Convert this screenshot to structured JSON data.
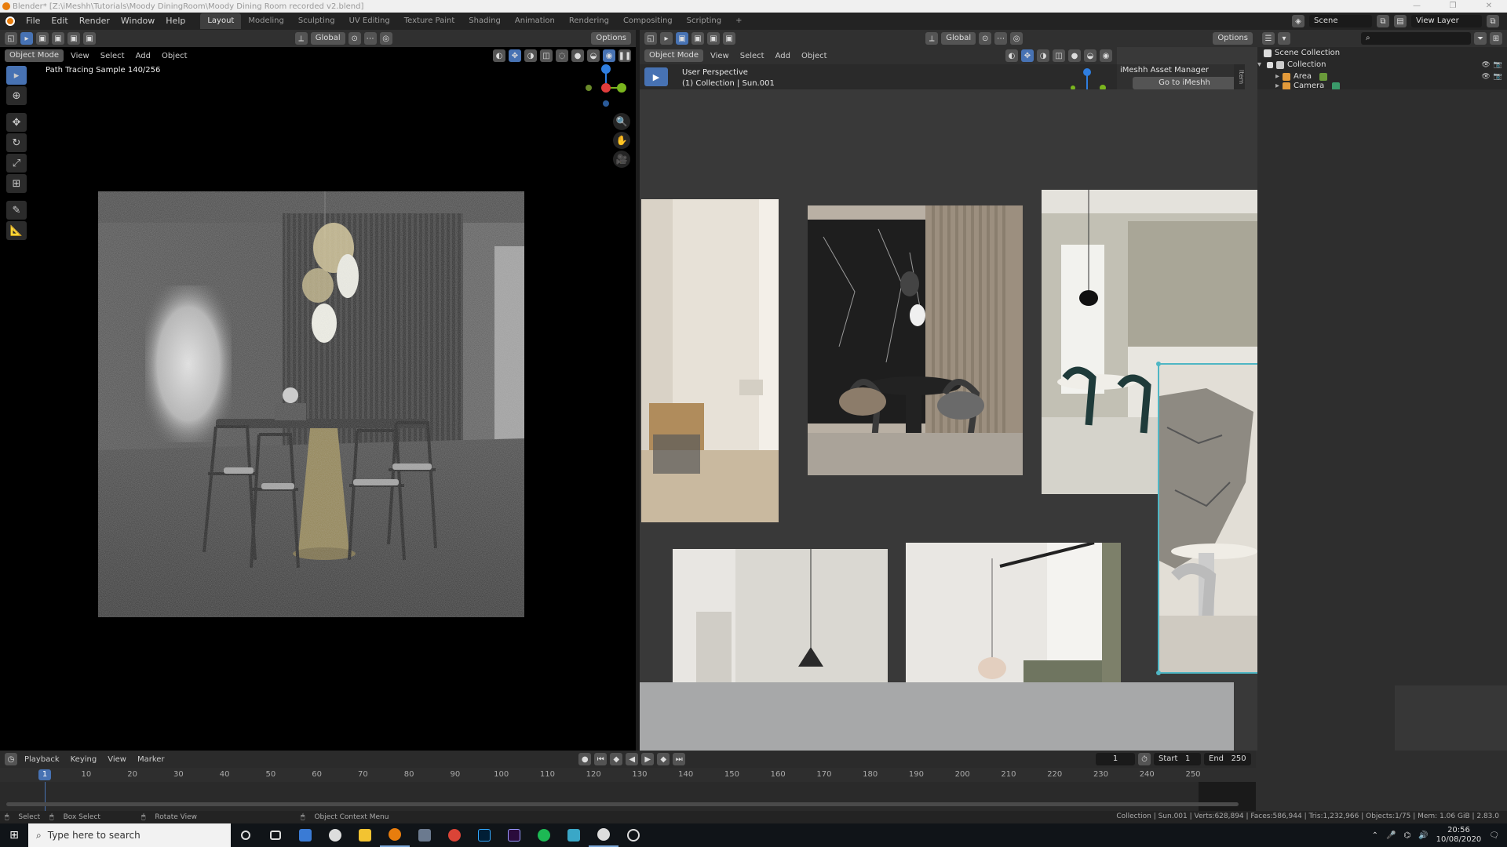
{
  "window": {
    "title": "Blender* [Z:\\iMeshh\\Tutorials\\Moody DiningRoom\\Moody Dining Room recorded v2.blend]",
    "controls": [
      "—",
      "❐",
      "✕"
    ]
  },
  "menubar": {
    "items": [
      "File",
      "Edit",
      "Render",
      "Window",
      "Help"
    ],
    "workspaces": [
      "Layout",
      "Modeling",
      "Sculpting",
      "UV Editing",
      "Texture Paint",
      "Shading",
      "Animation",
      "Rendering",
      "Compositing",
      "Scripting"
    ],
    "active_workspace": "Layout",
    "add_tab": "+",
    "scene": "Scene",
    "view_layer": "View Layer"
  },
  "left_viewport": {
    "mode": "Object Mode",
    "menus": [
      "View",
      "Select",
      "Add",
      "Object"
    ],
    "transform": "Global",
    "options": "Options",
    "render_info": "Path Tracing Sample 140/256"
  },
  "right_viewport": {
    "mode": "Object Mode",
    "menus": [
      "View",
      "Select",
      "Add",
      "Object"
    ],
    "transform": "Global",
    "options": "Options",
    "perspective": "User Perspective",
    "collection_info": "(1) Collection | Sun.001",
    "asset_manager": {
      "title": "iMeshh Asset Manager",
      "button": "Go to iMeshh"
    },
    "side_tab": "Item"
  },
  "outliner": {
    "rows": [
      {
        "label": "Scene Collection",
        "indent": 0
      },
      {
        "label": "Collection",
        "indent": 1
      },
      {
        "label": "Area",
        "indent": 2
      },
      {
        "label": "Camera",
        "indent": 2
      }
    ]
  },
  "timeline": {
    "menus": [
      "Playback",
      "Keying",
      "View",
      "Marker"
    ],
    "current_frame": "1",
    "start_label": "Start",
    "start": "1",
    "end_label": "End",
    "end": "250",
    "ticks": [
      "10",
      "20",
      "30",
      "40",
      "50",
      "60",
      "70",
      "80",
      "90",
      "100",
      "110",
      "120",
      "130",
      "140",
      "150",
      "160",
      "170",
      "180",
      "190",
      "200",
      "210",
      "220",
      "230",
      "240",
      "250"
    ],
    "cursor": "1"
  },
  "statusbar": {
    "select": "Select",
    "box_select": "Box Select",
    "rotate": "Rotate View",
    "context": "Object Context Menu",
    "stats": "Collection | Sun.001 | Verts:628,894 | Faces:586,944 | Tris:1,232,966 | Objects:1/75 | Mem: 1.06 GiB | 2.83.0"
  },
  "taskbar": {
    "search_placeholder": "Type here to search",
    "time": "20:56",
    "date": "10/08/2020"
  },
  "colors": {
    "accent": "#4772b3",
    "selection": "#4fb6c4",
    "blender_orange": "#e87d0d"
  }
}
